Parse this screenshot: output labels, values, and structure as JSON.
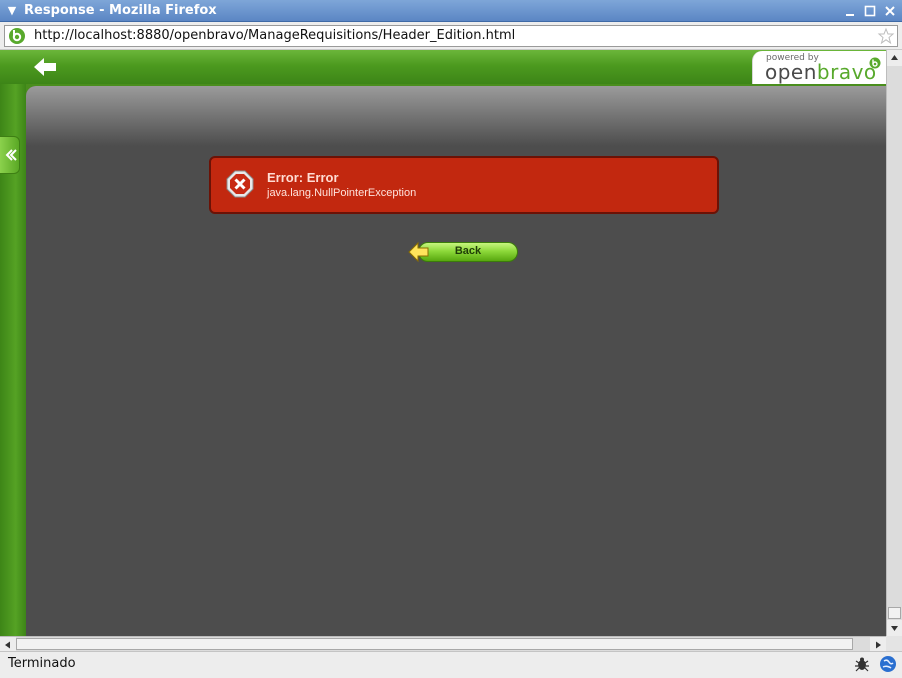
{
  "window": {
    "title": "Response - Mozilla Firefox"
  },
  "address_bar": {
    "url": "http://localhost:8880/openbravo/ManageRequisitions/Header_Edition.html"
  },
  "header": {
    "logo_powered_by": "powered by",
    "logo_brand_prefix": "open",
    "logo_brand_suffix": "bravo"
  },
  "error": {
    "title": "Error: Error",
    "message": "java.lang.NullPointerException"
  },
  "actions": {
    "back_label": "Back"
  },
  "status_bar": {
    "text": "Terminado"
  },
  "colors": {
    "brand_green": "#58a92c",
    "error_red": "#c2280f",
    "content_gray": "#4d4d4d"
  }
}
